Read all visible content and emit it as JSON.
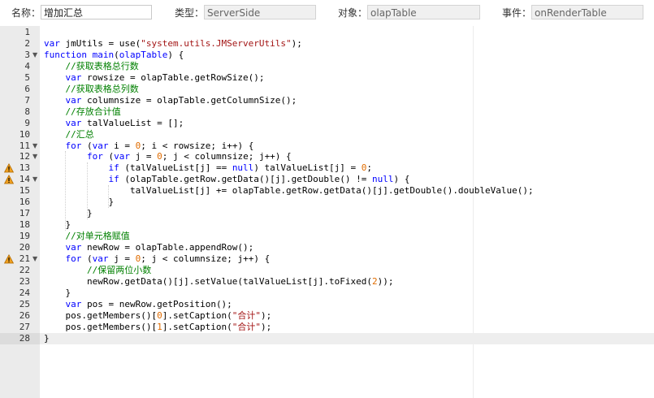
{
  "props": {
    "name_label": "名称：",
    "name_value": "增加汇总",
    "type_label": "类型：",
    "type_value": "ServerSide",
    "object_label": "对象：",
    "object_value": "olapTable",
    "event_label": "事件：",
    "event_value": "onRenderTable"
  },
  "editor": {
    "lines": [
      {
        "n": "1",
        "text": "",
        "fold": false,
        "warn": false
      },
      {
        "n": "2",
        "text": "var jmUtils = use(\"system.utils.JMServerUtils\");",
        "fold": false,
        "warn": false
      },
      {
        "n": "3",
        "text": "function main(olapTable) {",
        "fold": true,
        "warn": false
      },
      {
        "n": "4",
        "text": "    //获取表格总行数",
        "fold": false,
        "warn": false
      },
      {
        "n": "5",
        "text": "    var rowsize = olapTable.getRowSize();",
        "fold": false,
        "warn": false
      },
      {
        "n": "6",
        "text": "    //获取表格总列数",
        "fold": false,
        "warn": false
      },
      {
        "n": "7",
        "text": "    var columnsize = olapTable.getColumnSize();",
        "fold": false,
        "warn": false
      },
      {
        "n": "8",
        "text": "    //存放合计值",
        "fold": false,
        "warn": false
      },
      {
        "n": "9",
        "text": "    var talValueList = [];",
        "fold": false,
        "warn": false
      },
      {
        "n": "10",
        "text": "    //汇总",
        "fold": false,
        "warn": false
      },
      {
        "n": "11",
        "text": "    for (var i = 0; i < rowsize; i++) {",
        "fold": true,
        "warn": false
      },
      {
        "n": "12",
        "text": "        for (var j = 0; j < columnsize; j++) {",
        "fold": true,
        "warn": false
      },
      {
        "n": "13",
        "text": "            if (talValueList[j] == null) talValueList[j] = 0;",
        "fold": false,
        "warn": true
      },
      {
        "n": "14",
        "text": "            if (olapTable.getRow.getData()[j].getDouble() != null) {",
        "fold": true,
        "warn": true
      },
      {
        "n": "15",
        "text": "                talValueList[j] += olapTable.getRow.getData()[j].getDouble().doubleValue();",
        "fold": false,
        "warn": false
      },
      {
        "n": "16",
        "text": "            }",
        "fold": false,
        "warn": false
      },
      {
        "n": "17",
        "text": "        }",
        "fold": false,
        "warn": false
      },
      {
        "n": "18",
        "text": "    }",
        "fold": false,
        "warn": false
      },
      {
        "n": "19",
        "text": "    //对单元格赋值",
        "fold": false,
        "warn": false
      },
      {
        "n": "20",
        "text": "    var newRow = olapTable.appendRow();",
        "fold": false,
        "warn": false
      },
      {
        "n": "21",
        "text": "    for (var j = 0; j < columnsize; j++) {",
        "fold": true,
        "warn": true
      },
      {
        "n": "22",
        "text": "        //保留两位小数",
        "fold": false,
        "warn": false
      },
      {
        "n": "23",
        "text": "        newRow.getData()[j].setValue(talValueList[j].toFixed(2));",
        "fold": false,
        "warn": false
      },
      {
        "n": "24",
        "text": "    }",
        "fold": false,
        "warn": false
      },
      {
        "n": "25",
        "text": "    var pos = newRow.getPosition();",
        "fold": false,
        "warn": false
      },
      {
        "n": "26",
        "text": "    pos.getMembers()[0].setCaption(\"合计\");",
        "fold": false,
        "warn": false
      },
      {
        "n": "27",
        "text": "    pos.getMembers()[1].setCaption(\"合计\");",
        "fold": false,
        "warn": false
      },
      {
        "n": "28",
        "text": "}",
        "fold": false,
        "warn": false,
        "active": true
      }
    ]
  },
  "colors": {
    "keyword": "#0000ff",
    "string": "#a31515",
    "comment": "#008000",
    "number": "#e06c00",
    "gutter": "#ebebeb",
    "warning": "#f0a020"
  },
  "icons": {
    "fold": "chevron-down-icon",
    "warning": "warning-icon"
  }
}
